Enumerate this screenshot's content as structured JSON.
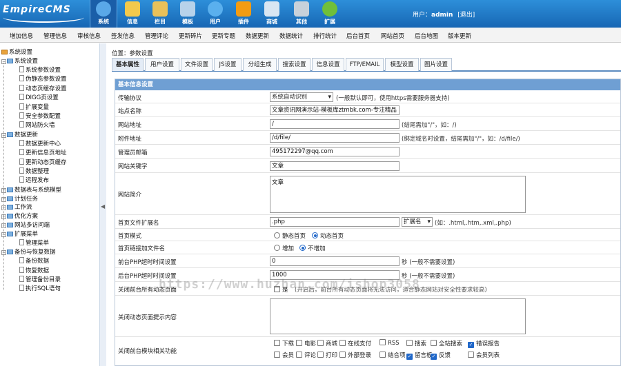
{
  "logo": "EmpireCMS",
  "main_nav": [
    {
      "label": "系统",
      "icon": "globe-icon",
      "color": "#5aa8e8"
    },
    {
      "label": "信息",
      "icon": "pencil-icon",
      "color": "#f2c94c"
    },
    {
      "label": "栏目",
      "icon": "folder-icon",
      "color": "#e9c15a"
    },
    {
      "label": "模板",
      "icon": "template-icon",
      "color": "#b7d2ea"
    },
    {
      "label": "用户",
      "icon": "user-icon",
      "color": "#5ab0ee"
    },
    {
      "label": "插件",
      "icon": "tools-icon",
      "color": "#f39c12"
    },
    {
      "label": "商城",
      "icon": "shop-icon",
      "color": "#d9e6f2"
    },
    {
      "label": "其他",
      "icon": "gear-icon",
      "color": "#c8d1da"
    },
    {
      "label": "扩展",
      "icon": "plus-icon",
      "color": "#6fbf3a"
    }
  ],
  "user": {
    "prefix": "用户：",
    "name": "admin",
    "logout": "[退出]"
  },
  "sub_nav": [
    "增加信息",
    "管理信息",
    "审核信息",
    "签发信息",
    "管理评论",
    "更新碎片",
    "更新专题",
    "数据更新",
    "数据统计",
    "排行统计",
    "后台首页",
    "网站首页",
    "后台地图",
    "版本更新"
  ],
  "tree": {
    "root": "系统设置",
    "sys": "系统设置",
    "sys_items": [
      "系统参数设置",
      "伪静态参数设置",
      "动态页缓存设置",
      "DIGG页设置",
      "扩展变量",
      "安全参数配置",
      "网站防火墙"
    ],
    "upd": "数据更新",
    "upd_items": [
      "数据更新中心",
      "更新信息页地址",
      "更新动态页缓存",
      "数据整理",
      "远程发布"
    ],
    "g1": "数据表与系统模型",
    "g2": "计划任务",
    "g3": "工作流",
    "g4": "优化方案",
    "g5": "网站多访问端",
    "ext": "扩展菜单",
    "ext_items": [
      "管理菜单"
    ],
    "bak": "备份与恢复数据",
    "bak_items": [
      "备份数据",
      "恢复数据",
      "管理备份目录",
      "执行SQL语句"
    ]
  },
  "breadcrumb": "位置：参数设置",
  "tabs": [
    "基本属性",
    "用户设置",
    "文件设置",
    "JS设置",
    "分组生成",
    "搜索设置",
    "信息设置",
    "FTP/EMAIL",
    "模型设置",
    "图片设置"
  ],
  "form": {
    "header": "基本信息设置",
    "protocol": {
      "label": "传输协议",
      "value": "系统自动识别",
      "hint": "(一般默认即可，使用https需要服务器支持)"
    },
    "sitename": {
      "label": "站点名称",
      "value": "文章资讯网演示站-模板库ztmbk.com-专注精品"
    },
    "siteurl": {
      "label": "网站地址",
      "value": "/",
      "hint": "(结尾需加\"/\"，如：/)"
    },
    "attachurl": {
      "label": "附件地址",
      "value": "/d/file/",
      "hint": "(绑定域名时设置，结尾需加\"/\"，如：/d/file/)"
    },
    "email": {
      "label": "管理员邮箱",
      "value": "495172297@qq.com"
    },
    "keywords": {
      "label": "网站关键字",
      "value": "文章"
    },
    "desc": {
      "label": "网站简介",
      "value": "文章"
    },
    "ext": {
      "label": "首页文件扩展名",
      "value": ".php",
      "select": "扩展名",
      "hint": "(如：.html,.htm,.xml,.php)"
    },
    "mode": {
      "label": "首页模式",
      "opt1": "静态首页",
      "opt2": "动态首页"
    },
    "link": {
      "label": "首页链接加文件名",
      "opt1": "增加",
      "opt2": "不增加"
    },
    "front_timeout": {
      "label": "前台PHP超时时间设置",
      "value": "0",
      "unit": "秒 (一般不需要设置)"
    },
    "back_timeout": {
      "label": "后台PHP超时时间设置",
      "value": "1000",
      "unit": "秒 (一般不需要设置)"
    },
    "close_dyn": {
      "label": "关闭前台所有动态页面",
      "opt": "是",
      "hint": "(开启后，前台所有动态页面将无法访问，适合静态网站对安全性要求较高)"
    },
    "close_tip": {
      "label": "关闭动态页面提示内容"
    },
    "close_mods": {
      "label": "关闭前台模块相关功能",
      "row1": [
        {
          "t": "下载",
          "c": false
        },
        {
          "t": "电影",
          "c": false
        },
        {
          "t": "商城",
          "c": false
        },
        {
          "t": "在线支付",
          "c": false
        },
        {
          "t": "RSS",
          "c": false
        },
        {
          "t": "搜索",
          "c": false
        },
        {
          "t": "全站搜索",
          "c": false
        },
        {
          "t": "错误报告",
          "c": true
        }
      ],
      "row2": [
        {
          "t": "会员",
          "c": false
        },
        {
          "t": "评论",
          "c": false
        },
        {
          "t": "打印",
          "c": false
        },
        {
          "t": "外部登录",
          "c": false
        },
        {
          "t": "结合项",
          "c": false
        },
        {
          "t": "留言板",
          "c": true
        },
        {
          "t": "反馈",
          "c": true
        },
        {
          "t": "会员列表",
          "c": false
        }
      ]
    }
  },
  "watermark": "https://www.huzhan.com/ishop3058"
}
